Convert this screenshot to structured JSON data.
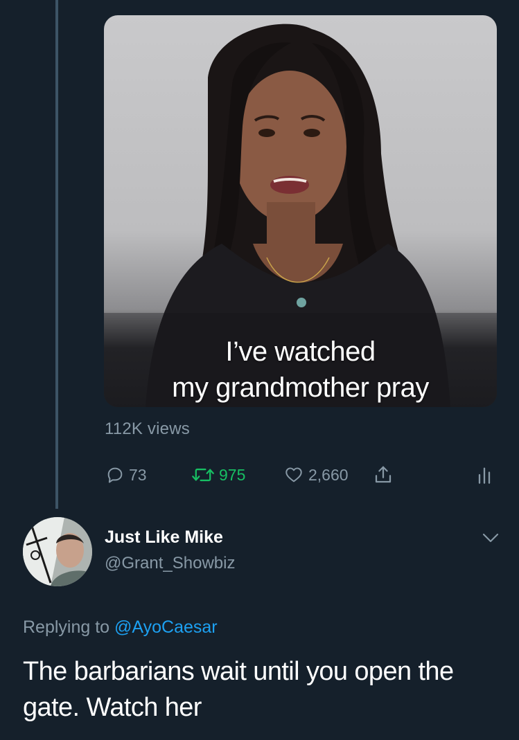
{
  "media": {
    "caption_line1": "I’ve watched",
    "caption_line2": "my grandmother pray"
  },
  "views_text": "112K views",
  "actions": {
    "replies": "73",
    "retweets": "975",
    "likes": "2,660"
  },
  "colors": {
    "background": "#15202b",
    "muted": "#8899a6",
    "retweet_active": "#17bf63",
    "link": "#1da1f2"
  },
  "reply_tweet": {
    "author_name": "Just Like Mike",
    "author_handle": "@Grant_Showbiz",
    "replying_prefix": "Replying to ",
    "replying_mention": "@AyoCaesar",
    "text": "The barbarians wait until you open the gate. Watch her"
  },
  "icons": {
    "reply": "reply-icon",
    "retweet": "retweet-icon",
    "like": "heart-icon",
    "share": "share-icon",
    "stats": "analytics-icon",
    "more": "chevron-down-icon"
  }
}
